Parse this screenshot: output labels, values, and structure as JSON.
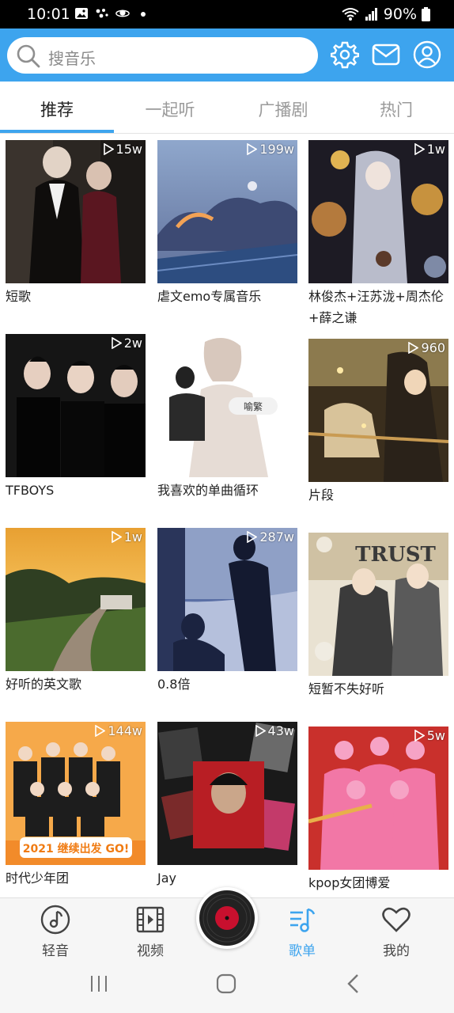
{
  "status": {
    "time": "10:01",
    "battery": "90%"
  },
  "header": {
    "search_placeholder": "搜音乐"
  },
  "tabs": [
    {
      "label": "推荐",
      "active": true
    },
    {
      "label": "一起听",
      "active": false
    },
    {
      "label": "广播剧",
      "active": false
    },
    {
      "label": "热门",
      "active": false
    }
  ],
  "playlists": [
    {
      "title": "短歌",
      "plays": "15w"
    },
    {
      "title": "虐文emo专属音乐",
      "plays": "199w"
    },
    {
      "title": "林俊杰+汪苏泷+周杰伦+薛之谦",
      "plays": "1w"
    },
    {
      "title": "TFBOYS",
      "plays": "2w"
    },
    {
      "title": "我喜欢的单曲循环",
      "plays": "",
      "thumb_text": "喻繁"
    },
    {
      "title": "片段",
      "plays": "960"
    },
    {
      "title": "好听的英文歌",
      "plays": "1w"
    },
    {
      "title": "0.8倍",
      "plays": "287w"
    },
    {
      "title": "短暂不失好听",
      "plays": "",
      "thumb_text": "TRUST"
    },
    {
      "title": "时代少年团",
      "plays": "144w",
      "thumb_text": "2021 继续出发 GO!"
    },
    {
      "title": "Jay",
      "plays": "43w"
    },
    {
      "title": "kpop女团博爱",
      "plays": "5w"
    }
  ],
  "bottom_nav": [
    {
      "label": "轻音",
      "icon": "music-note-icon",
      "active": false
    },
    {
      "label": "视频",
      "icon": "film-icon",
      "active": false
    },
    {
      "label": "歌单",
      "icon": "playlist-icon",
      "active": true
    },
    {
      "label": "我的",
      "icon": "heart-icon",
      "active": false
    }
  ],
  "colors": {
    "accent": "#3da4ee",
    "header_bg": "#3da4ee",
    "disc": "#c8102e"
  }
}
